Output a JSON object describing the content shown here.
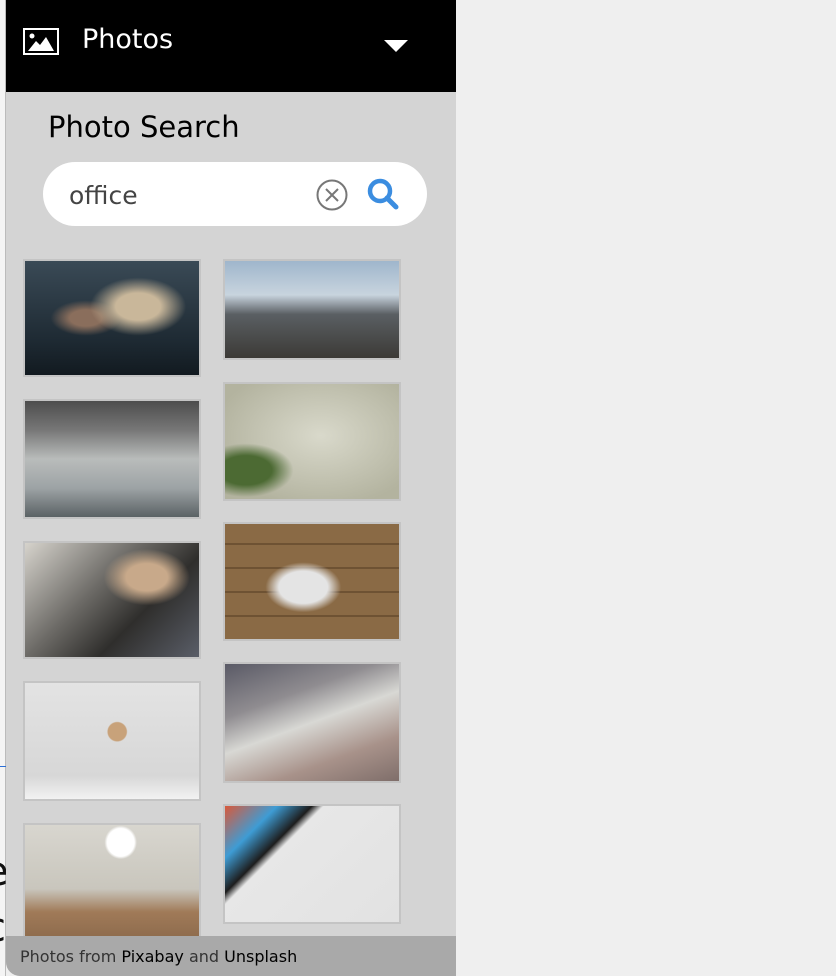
{
  "header": {
    "title": "Photos",
    "icon": "image-icon",
    "dropdown_icon": "caret-down-icon"
  },
  "search": {
    "title": "Photo Search",
    "value": "office",
    "clear_icon": "clear-circle-icon",
    "search_icon": "search-icon",
    "accent": "#3b8de0"
  },
  "background": {
    "chars": [
      "e",
      "c"
    ]
  },
  "footer": {
    "prefix": "Photos from",
    "source1": "Pixabay",
    "middle": "and",
    "source2": "Unsplash"
  }
}
